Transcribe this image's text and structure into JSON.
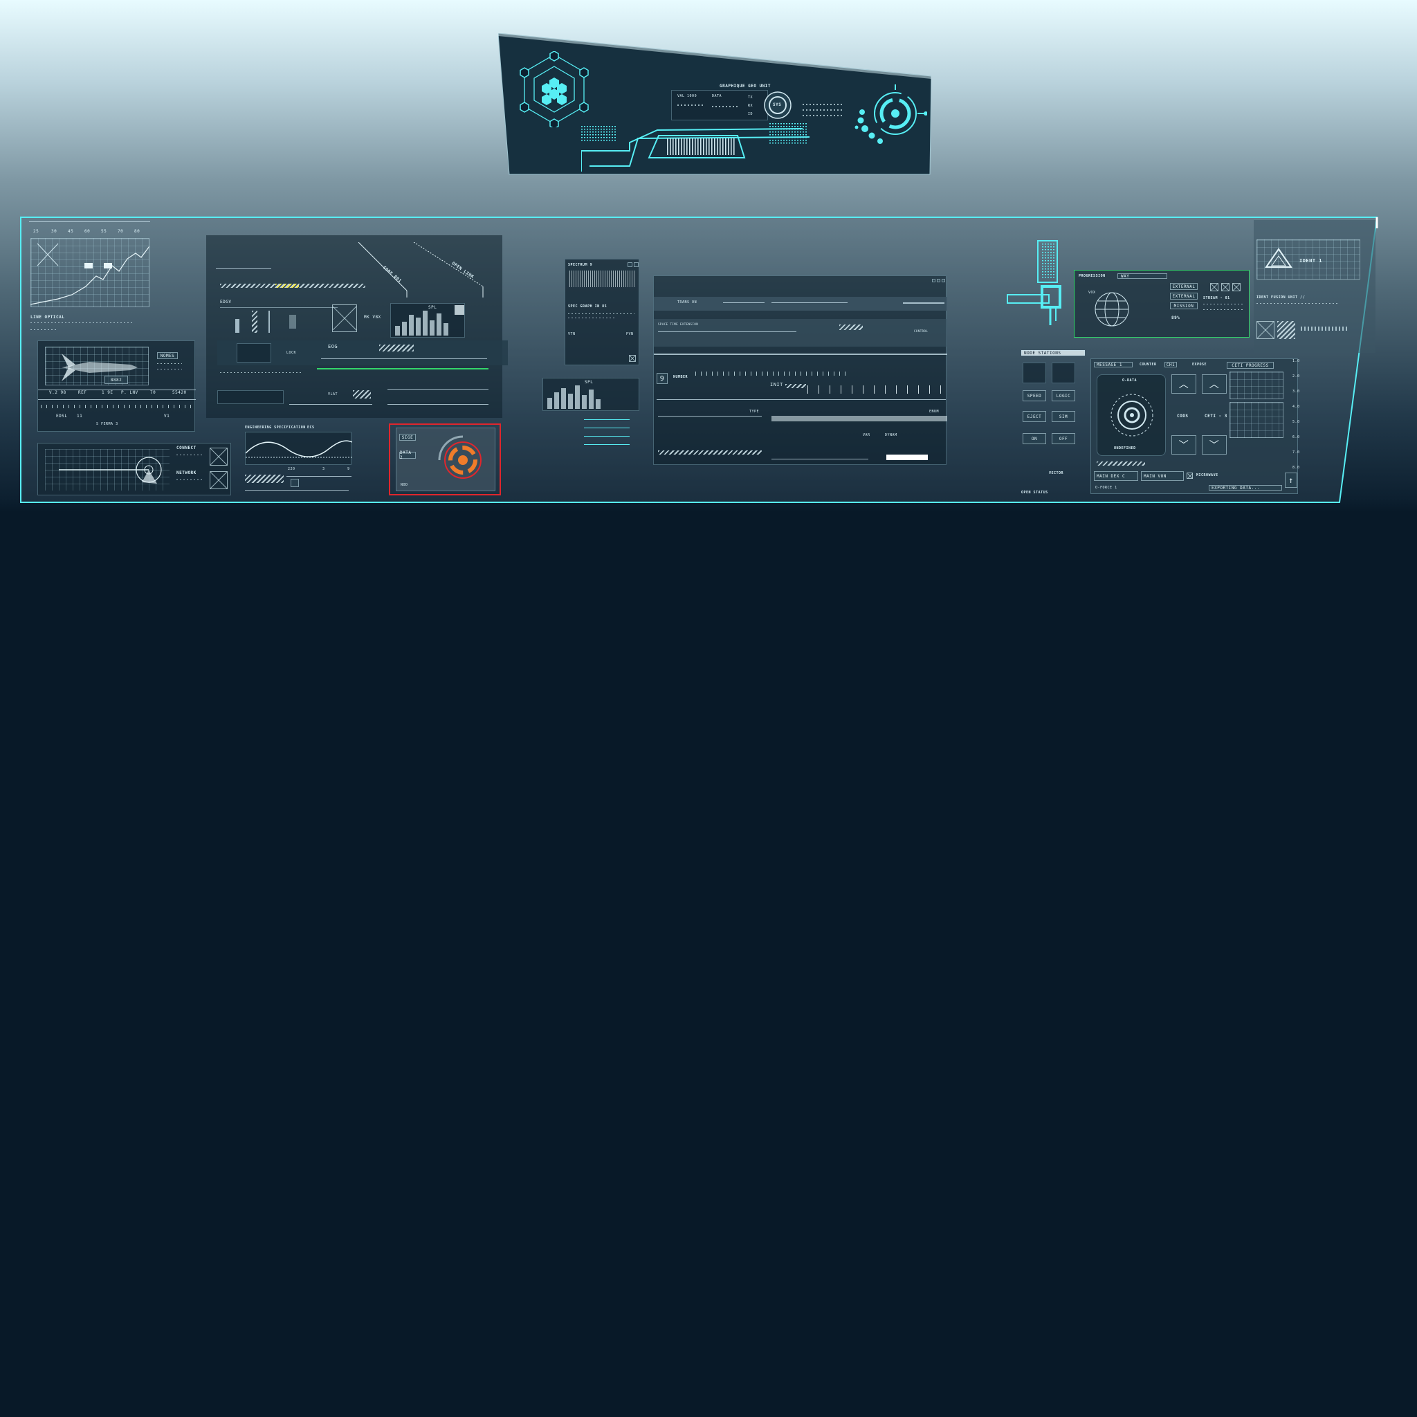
{
  "colors": {
    "accent": "#57eef4",
    "selection_red": "#e0262c",
    "selection_green": "#33d66a",
    "background": "#081928"
  },
  "hud": {
    "title": "GRAPHIQUE GEO UNIT",
    "dial_label": "SYS",
    "readouts": [
      "VAL 1000",
      "DATA",
      "TX",
      "RX",
      "ID"
    ]
  },
  "left": {
    "graph_ticks": [
      "25",
      "30",
      "45",
      "60",
      "55",
      "70",
      "80"
    ],
    "graph_caption": "LINE OPTICAL",
    "readout_box": "8882",
    "tag_nomes": "NOMES",
    "row_labels": [
      "V.2 98",
      "REF",
      "1 9E",
      "P. LNV",
      "70",
      "55420"
    ],
    "status_row": [
      "EDSL",
      "11",
      "S FERMA 3",
      "V1"
    ],
    "connect": "CONNECT",
    "network": "NETWORK"
  },
  "mid": {
    "callout_1": "CORE 001",
    "callout_2": "OPEN LINK",
    "edge_label": "EDGV",
    "spl_label": "SPL",
    "mid_label": "MK VBX",
    "eog_label": "EOG",
    "lock_label": "LOCK",
    "vlat": "VLAT",
    "engineering": "ENGINEERING SPECIFICATION",
    "eng_code": "ECS",
    "eng_nums": [
      "220",
      "3",
      "9"
    ],
    "target_tags": [
      "SIGE",
      "DATA 2"
    ],
    "target_footer": "NOD"
  },
  "spectrum": {
    "title": "SPECTRUM 9",
    "subtitle": "SPEC GRAPH IN 85",
    "left_tag": "VTN",
    "right_tag": "PVN",
    "spl": "SPL"
  },
  "center": {
    "tab_label": "TRANS ON",
    "digit": "9",
    "number_label": "NUMBER",
    "init": "INIT",
    "type": "TYPE",
    "enum": "ENUM",
    "var": "VAR",
    "dynam": "DYNAM",
    "space": "SPACE TIME EXTENSION",
    "status": "CONTROL"
  },
  "right": {
    "progression": "PROGRESSION",
    "dropdown_value": "WAY",
    "vox": "VOX",
    "buttons_right": [
      "EXTERNAL",
      "EXTERNAL",
      "MISSION"
    ],
    "stream": "STREAM - 01",
    "percent": "89%",
    "ident": "IDENT 1",
    "ident_caption": "IDENT FUSION UNIT //",
    "node_stations": "NODE STATIONS",
    "message": "MESSAGE 1",
    "counter": "COUNTER",
    "counter_val": "CH1",
    "expose": "EXPOSE",
    "progress": "CETI PROGRESS",
    "o_data": "O-DATA",
    "undefined": "UNDEFINED",
    "codes": "CODS",
    "ceti": "CETI - 3",
    "side_buttons": [
      "SPEED",
      "LOGIC",
      "EJECT",
      "SIM",
      "ON",
      "OFF"
    ],
    "vector": "VECTOR",
    "flow1": "MAIN DEX C",
    "flow2": "MAIN VON",
    "microwave": "MICROWAVE",
    "o_force": "O-FORCE 1",
    "exporting": "EXPORTING DATA...",
    "open_status": "OPEN  STATUS",
    "axis": [
      "1.0",
      "2.0",
      "3.0",
      "4.0",
      "5.0",
      "6.0",
      "7.0",
      "8.0"
    ]
  }
}
